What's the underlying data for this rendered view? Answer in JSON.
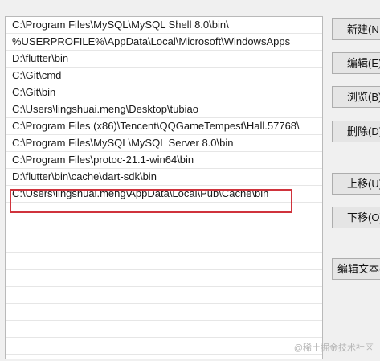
{
  "paths": [
    "C:\\Program Files\\MySQL\\MySQL Shell 8.0\\bin\\",
    "%USERPROFILE%\\AppData\\Local\\Microsoft\\WindowsApps",
    "D:\\flutter\\bin",
    "C:\\Git\\cmd",
    "C:\\Git\\bin",
    "C:\\Users\\lingshuai.meng\\Desktop\\tubiao",
    "C:\\Program Files (x86)\\Tencent\\QQGameTempest\\Hall.57768\\",
    "C:\\Program Files\\MySQL\\MySQL Server 8.0\\bin",
    "C:\\Program Files\\protoc-21.1-win64\\bin",
    "D:\\flutter\\bin\\cache\\dart-sdk\\bin",
    "C:\\Users\\lingshuai.meng\\AppData\\Local\\Pub\\Cache\\bin"
  ],
  "buttons": {
    "new": "新建(N",
    "edit": "编辑(E)",
    "browse": "浏览(B)...",
    "delete": "删除(D)",
    "move_up": "上移(U)",
    "move_down": "下移(O)",
    "edit_text": "编辑文本(T)"
  },
  "watermark": "@稀土掘金技术社区",
  "colors": {
    "highlight": "#d0333c"
  }
}
